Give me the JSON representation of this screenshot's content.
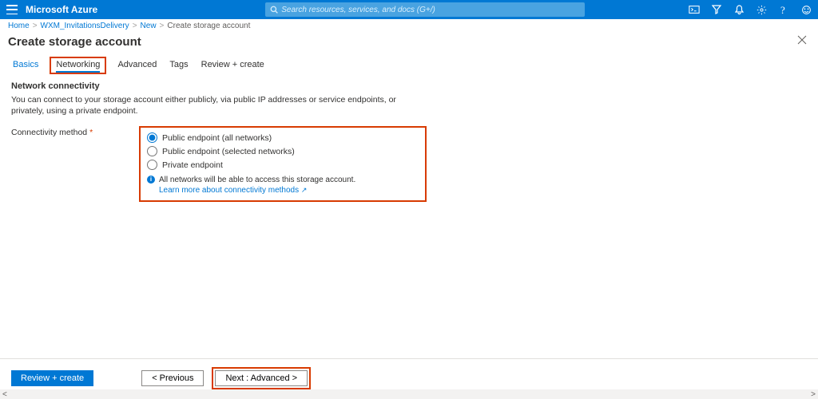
{
  "header": {
    "brand": "Microsoft Azure",
    "search_placeholder": "Search resources, services, and docs (G+/)"
  },
  "breadcrumb": {
    "items": [
      "Home",
      "WXM_InvitationsDelivery",
      "New",
      "Create storage account"
    ]
  },
  "blade": {
    "title": "Create storage account"
  },
  "tabs": {
    "items": [
      {
        "label": "Basics"
      },
      {
        "label": "Networking"
      },
      {
        "label": "Advanced"
      },
      {
        "label": "Tags"
      },
      {
        "label": "Review + create"
      }
    ]
  },
  "networking": {
    "section_title": "Network connectivity",
    "section_desc": "You can connect to your storage account either publicly, via public IP addresses or service endpoints, or privately, using a private endpoint.",
    "field_label": "Connectivity method",
    "options": {
      "opt_all": "Public endpoint (all networks)",
      "opt_selected": "Public endpoint (selected networks)",
      "opt_private": "Private endpoint"
    },
    "info_text": "All networks will be able to access this storage account.",
    "info_link": "Learn more about connectivity methods"
  },
  "footer": {
    "review_label": "Review + create",
    "previous_label": "< Previous",
    "next_label": "Next : Advanced >"
  }
}
